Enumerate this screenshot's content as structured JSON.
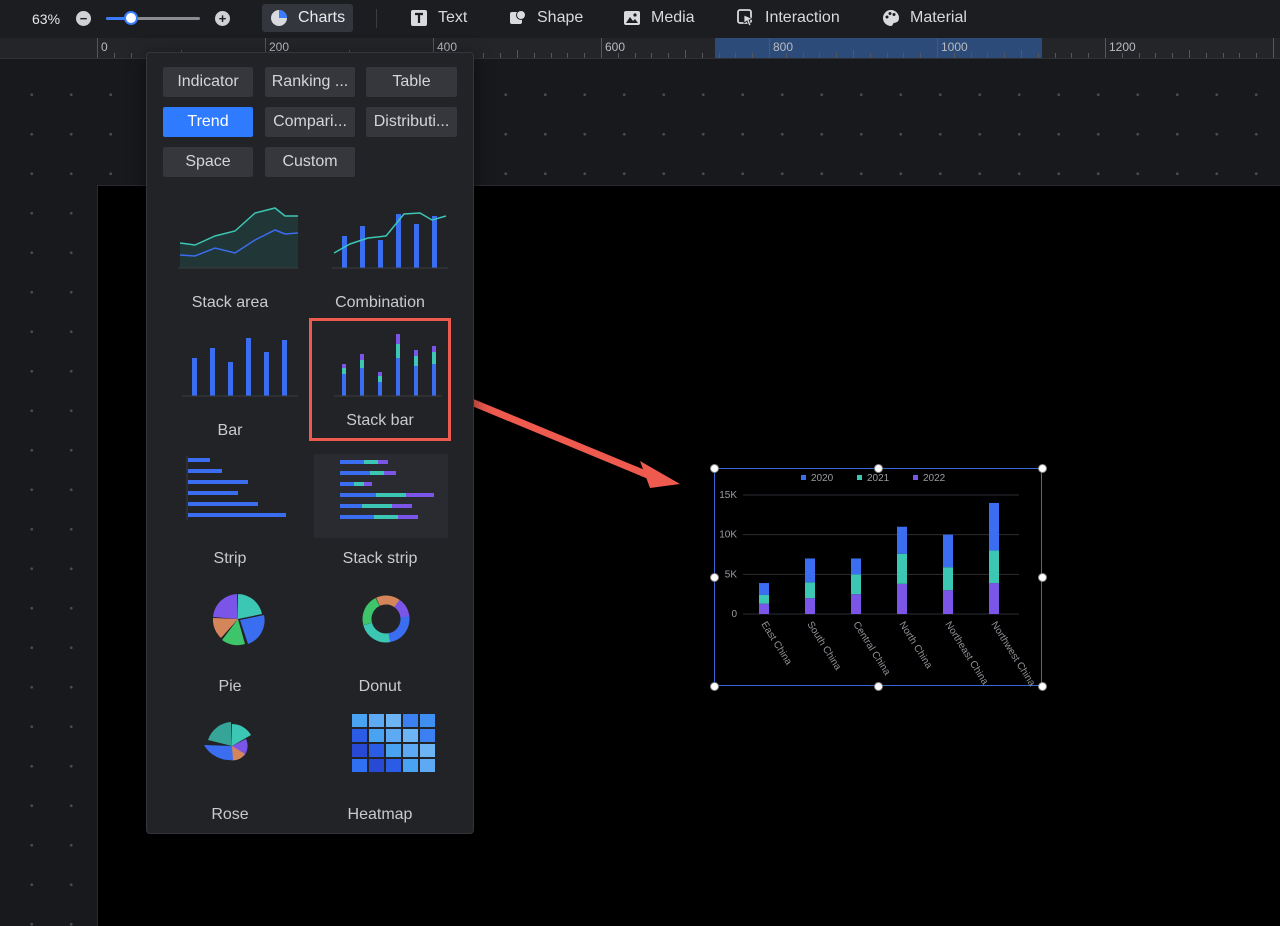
{
  "toolbar": {
    "zoom_value": "63%",
    "zoom_fraction": 0.27,
    "items": [
      {
        "label": "Charts",
        "icon": "chart-pie-icon",
        "active": true
      },
      {
        "label": "Text",
        "icon": "text-icon"
      },
      {
        "label": "Shape",
        "icon": "shape-icon"
      },
      {
        "label": "Media",
        "icon": "image-icon"
      },
      {
        "label": "Interaction",
        "icon": "interaction-icon"
      },
      {
        "label": "Material",
        "icon": "palette-icon"
      }
    ]
  },
  "ruler": {
    "labels": [
      "0",
      "200",
      "400",
      "600",
      "800",
      "1000",
      "1200"
    ]
  },
  "panel": {
    "categories": [
      {
        "label": "Indicator"
      },
      {
        "label": "Ranking ..."
      },
      {
        "label": "Table"
      },
      {
        "label": "Trend",
        "active": true
      },
      {
        "label": "Compari..."
      },
      {
        "label": "Distributi..."
      },
      {
        "label": "Space"
      },
      {
        "label": "Custom"
      }
    ],
    "charts": [
      {
        "label": "Stack area"
      },
      {
        "label": "Combination"
      },
      {
        "label": "Bar"
      },
      {
        "label": "Stack bar",
        "selected": true
      },
      {
        "label": "Strip"
      },
      {
        "label": "Stack strip"
      },
      {
        "label": "Pie"
      },
      {
        "label": "Donut"
      },
      {
        "label": "Rose"
      },
      {
        "label": "Heatmap"
      }
    ]
  },
  "colors": {
    "accent": "#2f7bff",
    "selection": "#ef5a4e",
    "series_2020": "#3a6df0",
    "series_2021": "#3cc6b4",
    "series_2022": "#7b55e8"
  },
  "chart_data": {
    "type": "bar",
    "stacked": true,
    "categories": [
      "East China",
      "South China",
      "Central China",
      "North China",
      "Northeast China",
      "Northwest China"
    ],
    "series": [
      {
        "name": "2022",
        "values": [
          1300,
          2000,
          2500,
          3800,
          3000,
          3900
        ]
      },
      {
        "name": "2021",
        "values": [
          1100,
          2000,
          2500,
          3800,
          2900,
          4100
        ]
      },
      {
        "name": "2020",
        "values": [
          1500,
          3000,
          2000,
          3400,
          4100,
          6000
        ]
      }
    ],
    "yticks": [
      "15K",
      "10K",
      "5K",
      "0"
    ],
    "ylim": [
      0,
      15000
    ],
    "legend": [
      "2020",
      "2021",
      "2022"
    ],
    "legend_position": "top-center",
    "grid": true
  }
}
